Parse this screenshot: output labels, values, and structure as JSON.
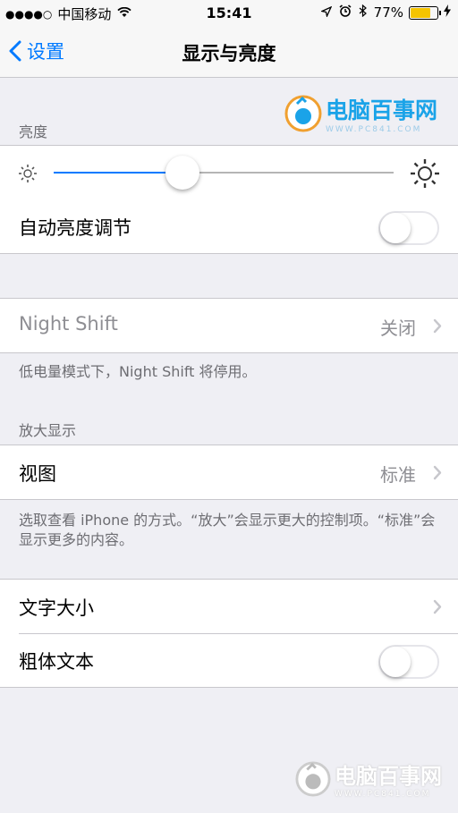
{
  "status_bar": {
    "signal_dots": "●●●●○",
    "carrier": "中国移动",
    "time": "15:41",
    "battery_percent": "77%",
    "battery_level": 0.77
  },
  "nav": {
    "back_label": "设置",
    "title": "显示与亮度"
  },
  "brightness": {
    "section_label": "亮度",
    "slider_value": 0.38,
    "auto_label": "自动亮度调节",
    "auto_on": false
  },
  "night_shift": {
    "label": "Night Shift",
    "value": "关闭",
    "note": "低电量模式下，Night Shift 将停用。"
  },
  "zoom": {
    "section_label": "放大显示",
    "view_label": "视图",
    "view_value": "标准",
    "note": "选取查看 iPhone 的方式。“放大”会显示更大的控制项。“标准”会显示更多的内容。"
  },
  "text": {
    "size_label": "文字大小",
    "bold_label": "粗体文本",
    "bold_on": false
  },
  "watermark": {
    "logo_text": "电脑百事网",
    "logo_url_text": "WWW.PC841.COM"
  },
  "colors": {
    "accent": "#007aff",
    "battery": "#f5c400",
    "background": "#efeff4"
  }
}
